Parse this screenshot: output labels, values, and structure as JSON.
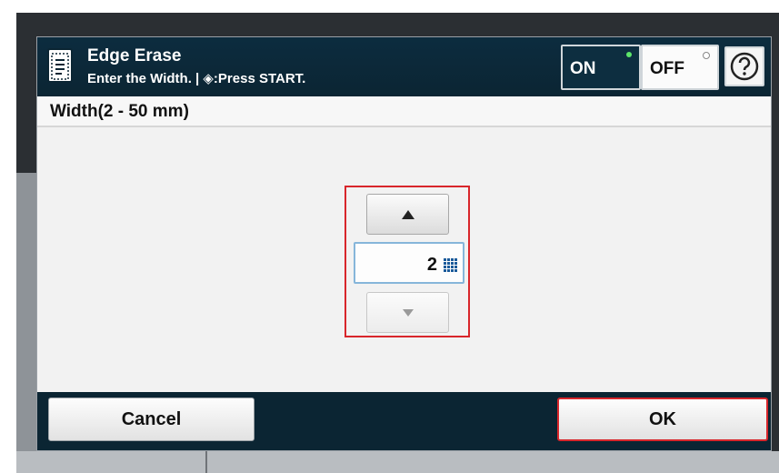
{
  "header": {
    "title": "Edge Erase",
    "subtitle": "Enter the Width. | ◈:Press START.",
    "on_label": "ON",
    "off_label": "OFF",
    "help_icon": "help-icon",
    "function_icon": "document-icon"
  },
  "field": {
    "label": "Width(2 - 50 mm)",
    "value": "2",
    "up_icon": "arrow-up-icon",
    "down_icon": "arrow-down-icon",
    "keypad_icon": "keypad-icon"
  },
  "footer": {
    "cancel_label": "Cancel",
    "ok_label": "OK"
  },
  "colors": {
    "header_bg": "#0c2c3f",
    "highlight": "#d8262b",
    "on_indicator": "#5ce66a"
  }
}
